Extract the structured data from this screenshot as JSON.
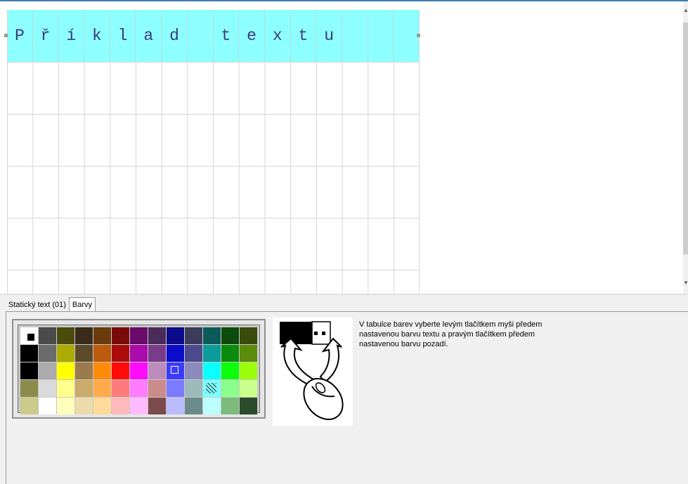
{
  "editor": {
    "cells": [
      "P",
      "ř",
      "í",
      "k",
      "l",
      "a",
      "d",
      " ",
      "t",
      "e",
      "x",
      "t",
      "u",
      " ",
      " ",
      " "
    ],
    "highlight_color": "#8effff",
    "text_color": "#3a3a7a"
  },
  "tabs": [
    {
      "label": "Statický text (01)",
      "active": false
    },
    {
      "label": "Barvy",
      "active": true
    }
  ],
  "palette": {
    "rows": [
      [
        "#ffffff",
        "#4b4b4b",
        "#4b4b0b",
        "#3b2b1b",
        "#6b3b0b",
        "#7b0b0b",
        "#6b0b6b",
        "#4b2b5b",
        "#0b0b8b",
        "#3b3b5b",
        "#0b5b5b",
        "#0b4b0b",
        "#3b4b0b"
      ],
      [
        "#000000",
        "#6b6b6b",
        "#abab00",
        "#5b4b2b",
        "#bb5b0b",
        "#ab0b0b",
        "#ab0bab",
        "#7b3b8b",
        "#0b0bcb",
        "#4b4b8b",
        "#0b9b9b",
        "#0b8b0b",
        "#5b8b0b"
      ],
      [
        "#000000",
        "#ababab",
        "#ffff00",
        "#9b7b4b",
        "#ff8b0b",
        "#ff0b0b",
        "#ff0bff",
        "#bb8bbb",
        "#3b3bff",
        "#8b8bbb",
        "#0bffff",
        "#0bff0b",
        "#9bff0b"
      ],
      [
        "#8b8b4b",
        "#dbdbdb",
        "#ffff8b",
        "#cbab6b",
        "#ffab4b",
        "#ff7b7b",
        "#ff7bff",
        "#cb8b8b",
        "#7b7bff",
        "#9bbbbb",
        "#7bffff",
        "#8bff8b",
        "#cbff8b"
      ],
      [
        "#cbcb8b",
        "#ffffff",
        "#ffffbb",
        "#ebdbab",
        "#ffdb9b",
        "#ffbbbb",
        "#ffbbff",
        "#7b4b4b",
        "#bbbbff",
        "#6b8b8b",
        "#bbffff",
        "#7bbb7b",
        "#2b4b2b"
      ]
    ],
    "foreground_marker": "#000000",
    "background_marker": "#0b0bcb",
    "transparent_marker": "#7bffff"
  },
  "illustration": {
    "icon": "mouse-hand-icon",
    "fg_box": "#000000",
    "bg_box": "#ffffff"
  },
  "help": {
    "line1": "V tabulce barev vyberte levým tlačítkem myši předem",
    "line2": "nastavenou barvu textu a pravým tlačítkem předem",
    "line3": "nastavenou barvu pozadí."
  }
}
